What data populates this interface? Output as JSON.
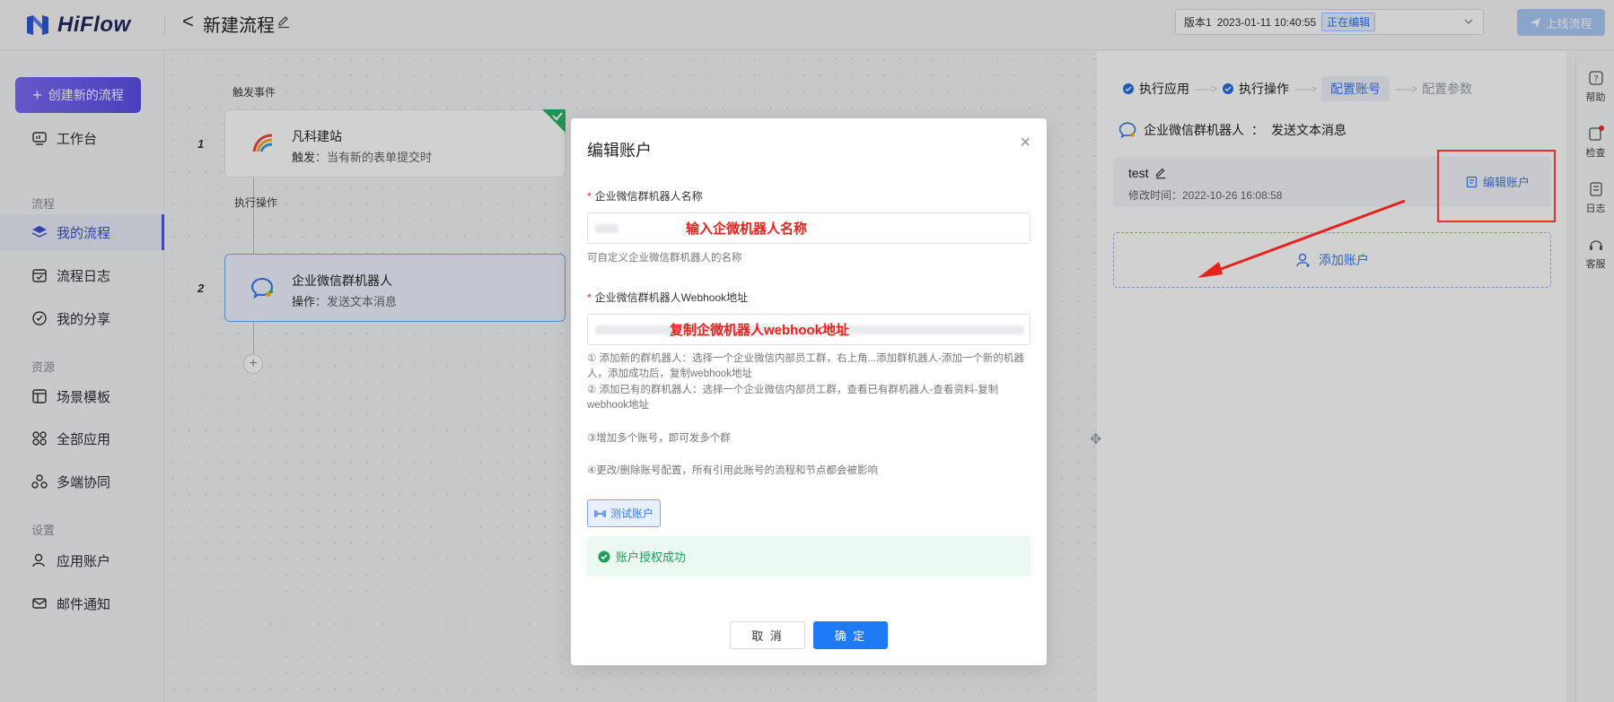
{
  "header": {
    "logo_text": "HiFlow",
    "back_glyph": "<",
    "flow_title": "新建流程",
    "version_label": "版本1",
    "version_time": "2023-01-11 10:40:55",
    "version_status": "正在编辑",
    "publish_label": "上线流程"
  },
  "sidebar": {
    "create_label": "创建新的流程",
    "items": [
      {
        "label": "工作台",
        "icon": "dashboard-icon"
      },
      {
        "label": "我的流程",
        "icon": "layers-icon",
        "active": true
      },
      {
        "label": "流程日志",
        "icon": "calendar-icon"
      },
      {
        "label": "我的分享",
        "icon": "share-icon"
      },
      {
        "label": "场景模板",
        "icon": "template-icon"
      },
      {
        "label": "全部应用",
        "icon": "apps-icon"
      },
      {
        "label": "多端协同",
        "icon": "collab-icon"
      },
      {
        "label": "应用账户",
        "icon": "user-icon"
      },
      {
        "label": "邮件通知",
        "icon": "mail-icon"
      }
    ],
    "sections": {
      "flow": "流程",
      "resource": "资源",
      "settings": "设置"
    }
  },
  "canvas": {
    "trigger_label": "触发事件",
    "action_label": "执行操作",
    "nodes": [
      {
        "num": "1",
        "title": "凡科建站",
        "sub_key": "触发",
        "sub_val": "当有新的表单提交时"
      },
      {
        "num": "2",
        "title": "企业微信群机器人",
        "sub_key": "操作",
        "sub_val": "发送文本消息"
      }
    ],
    "add_glyph": "+"
  },
  "right_panel": {
    "steps": [
      "执行应用",
      "执行操作",
      "配置账号",
      "配置参数"
    ],
    "step_arrow": "------>",
    "app_name": "企业微信群机器人",
    "app_sep": "：",
    "app_action": "发送文本消息",
    "account_name": "test",
    "account_time": "修改时间：2022-10-26 16:08:58",
    "edit_account": "编辑账户",
    "add_account": "添加账户"
  },
  "rail": {
    "items": [
      "帮助",
      "检查",
      "日志",
      "客服"
    ]
  },
  "modal": {
    "title": "编辑账户",
    "close": "×",
    "name_label": "企业微信群机器人名称",
    "name_overlay": "输入企微机器人名称",
    "name_hint": "可自定义企业微信群机器人的名称",
    "webhook_label": "企业微信群机器人Webhook地址",
    "webhook_overlay": "复制企微机器人webhook地址",
    "hint1": "① 添加新的群机器人：选择一个企业微信内部员工群，右上角...添加群机器人-添加一个新的机器人，添加成功后，复制webhook地址",
    "hint2": "② 添加已有的群机器人：选择一个企业微信内部员工群，查看已有群机器人-查看资料-复制webhook地址",
    "hint3": "③增加多个账号，即可发多个群",
    "hint4": "④更改/删除账号配置，所有引用此账号的流程和节点都会被影响",
    "test_label": "测试账户",
    "success_label": "账户授权成功",
    "cancel_label": "取 消",
    "ok_label": "确 定"
  },
  "colors": {
    "primary": "#1f7af5",
    "success": "#1c9d5a",
    "annotation": "#e3312d"
  }
}
